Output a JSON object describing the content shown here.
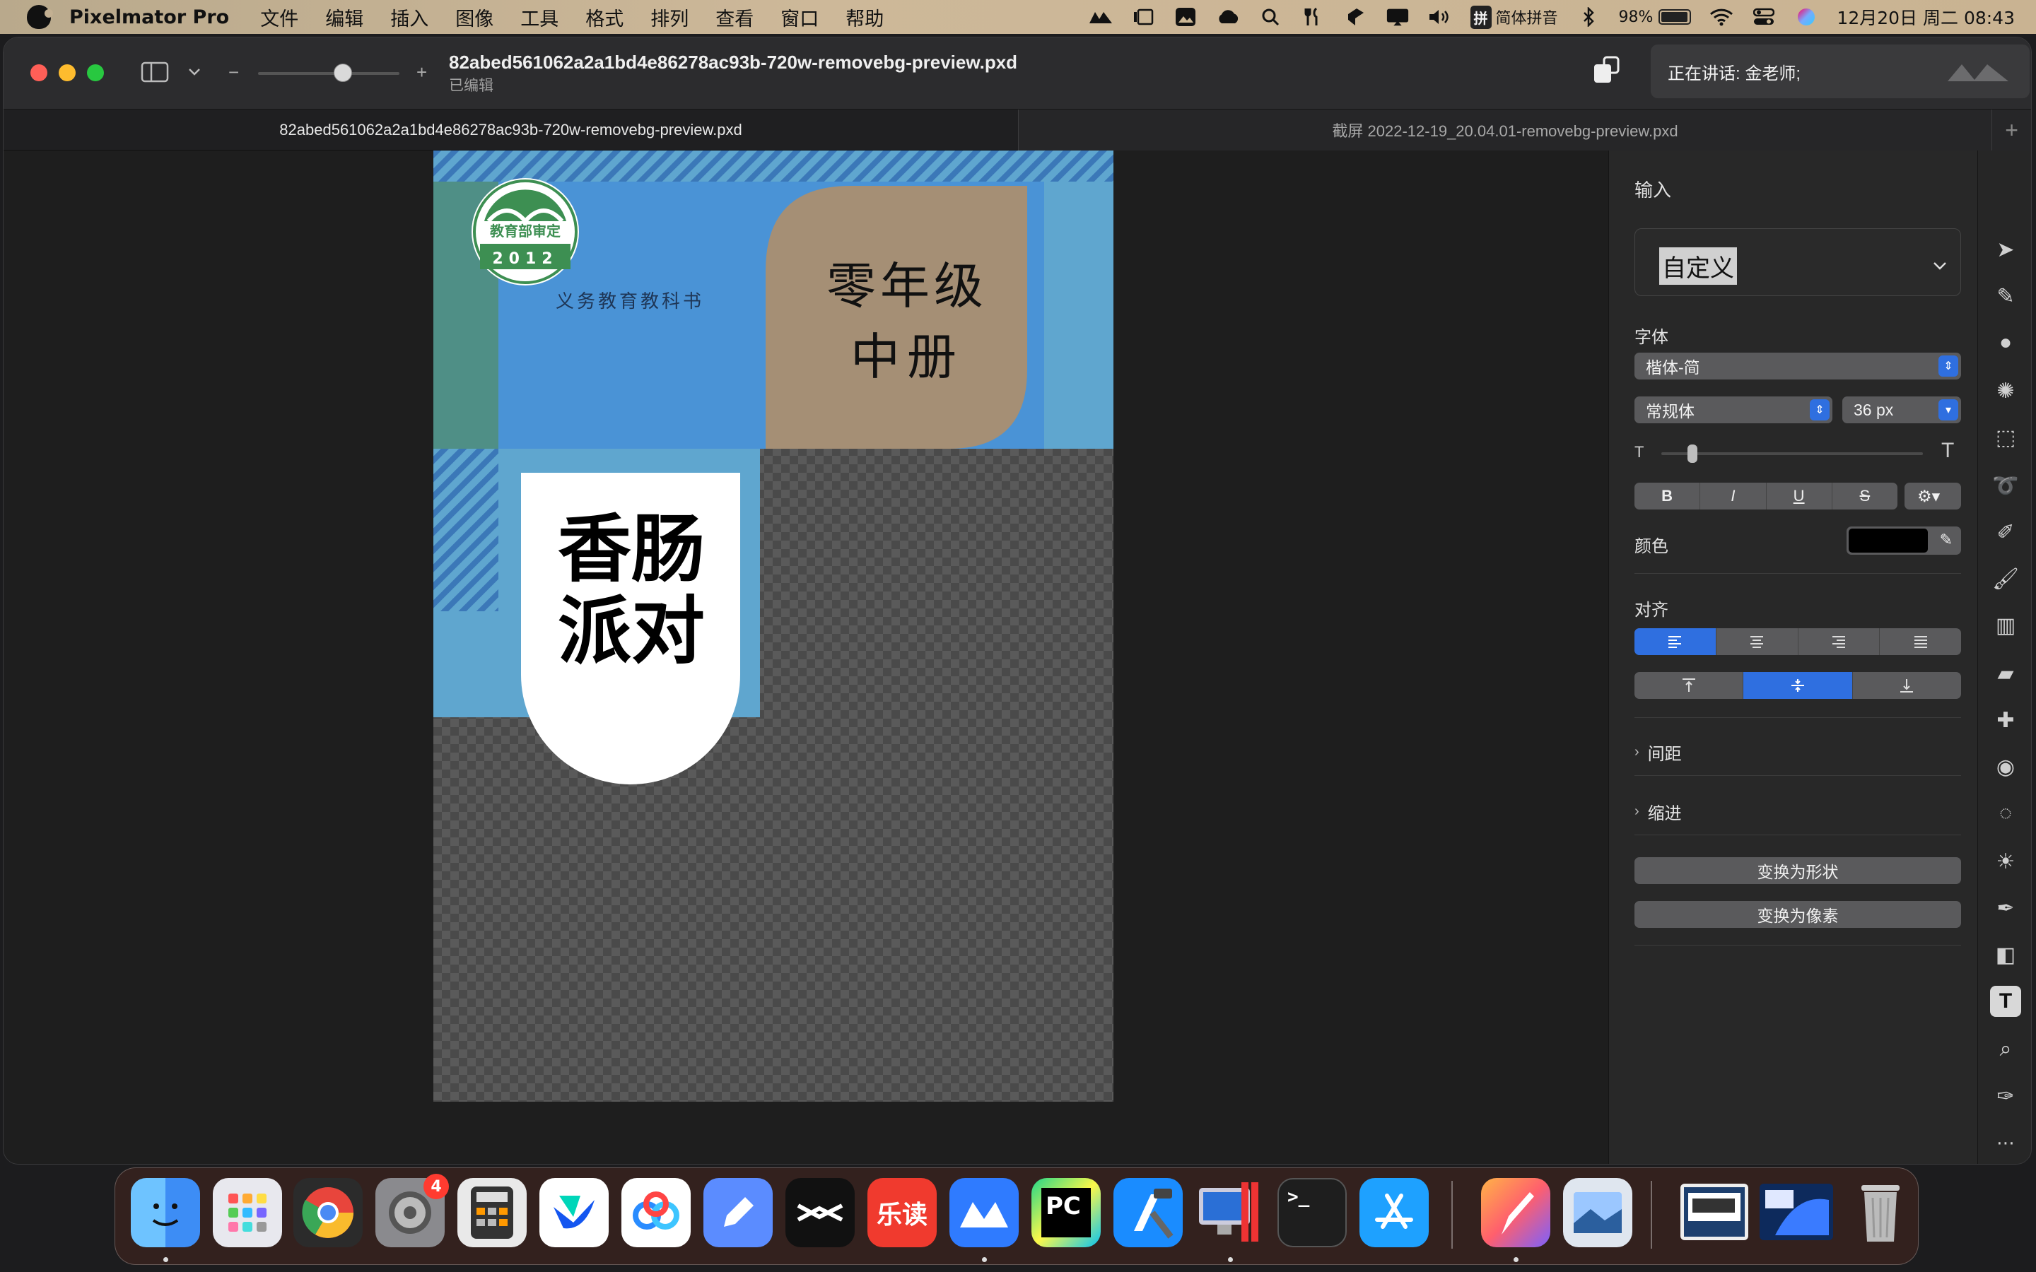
{
  "menubar": {
    "app_name": "Pixelmator Pro",
    "items": [
      "文件",
      "编辑",
      "插入",
      "图像",
      "工具",
      "格式",
      "排列",
      "查看",
      "窗口",
      "帮助"
    ],
    "input_method": "拼",
    "input_method_name": "简体拼音",
    "battery_percent": "98%",
    "battery_level": 0.98,
    "datetime": "12月20日 周二  08:43"
  },
  "window": {
    "filename": "82abed561062a2a1bd4e86278ac93b-720w-removebg-preview.pxd",
    "status": "已编辑",
    "zoom_level": 0.6,
    "speaking_banner": "正在讲话: 金老师;",
    "tabs": [
      {
        "label": "82abed561062a2a1bd4e86278ac93b-720w-removebg-preview.pxd",
        "active": true
      },
      {
        "label": "截屏 2022-12-19_20.04.01-removebg-preview.pxd",
        "active": false
      }
    ]
  },
  "document": {
    "seal_top": "教育部审定",
    "seal_year": "2012",
    "series": "义务教育教科书",
    "grade_line1": "零年级",
    "grade_line2": "中册",
    "title_line1": "香肠",
    "title_line2": "派对",
    "colors": {
      "blue": "#4a93d6",
      "tan": "#a58f75",
      "teal": "#4f8f86",
      "lightblue": "#5fa6cf",
      "stripe": "#3b78b8"
    }
  },
  "panel": {
    "section_title": "输入",
    "preset_value": "自定义",
    "font_label": "字体",
    "font_family": "楷体-简",
    "font_style": "常规体",
    "font_size": "36 px",
    "size_slider_level": 0.1,
    "style_buttons": [
      "B",
      "I",
      "U",
      "S"
    ],
    "color_label": "颜色",
    "text_color": "#000000",
    "align_label": "对齐",
    "spacing_label": "间距",
    "indent_label": "缩进",
    "convert_shape": "变换为形状",
    "convert_pixels": "变换为像素",
    "accent": "#2f6fe0"
  },
  "tools": [
    "arrange-tool-icon",
    "style-tool-icon",
    "color-adjust-icon",
    "effects-icon",
    "select-rect-icon",
    "lasso-icon",
    "quick-select-icon",
    "paint-icon",
    "fill-icon",
    "erase-icon",
    "repair-icon",
    "retouch-icon",
    "blur-icon",
    "lighten-icon",
    "pen-icon",
    "shapes-icon",
    "type-tool-icon",
    "zoom-icon",
    "eyedropper-icon",
    "more-icon"
  ],
  "dock": {
    "apps": [
      "Finder",
      "Launchpad",
      "Chrome Dev",
      "System Settings",
      "Calculator",
      "Lark",
      "Baidu Netdisk",
      "Notes",
      "CapCut",
      "乐读",
      "Tencent Meeting",
      "PyCharm",
      "Xcode",
      "Remote Desktop",
      "Terminal",
      "App Store",
      "Pixelmator Pro",
      "Preview",
      "Screenshot Thumb A",
      "Screenshot Thumb B",
      "Trash"
    ],
    "settings_badge": "4",
    "ledu_label": "乐读",
    "pycharm_label": "PC"
  }
}
